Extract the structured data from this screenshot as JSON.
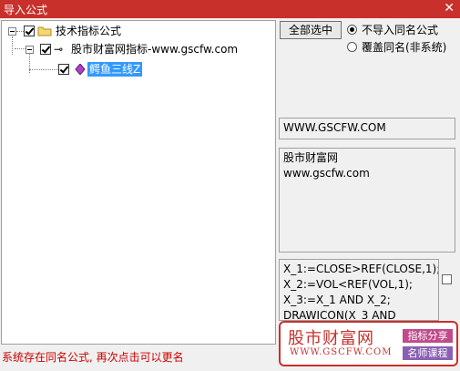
{
  "window": {
    "title": "导入公式",
    "close_glyph": "✕"
  },
  "tree": {
    "root_label": "技术指标公式",
    "child_label": "股市财富网指标-www.gscfw.com",
    "leaf_label": "鳄鱼三线Z"
  },
  "options": {
    "select_all_label": "全部选中",
    "radio_no_import": "不导入同名公式",
    "radio_overwrite": "覆盖同名(非系统)"
  },
  "info": {
    "website": "WWW.GSCFW.COM",
    "desc_line1": "股市财富网",
    "desc_line2": "www.gscfw.com",
    "code_lines": [
      "X_1:=CLOSE>REF(CLOSE,1);",
      "X_2:=VOL<REF(VOL,1);",
      "X_3:=X_1 AND X_2;",
      "DRAWICON(X_3 AND"
    ]
  },
  "status_text": "系统存在同名公式, 再次点击可以更名",
  "watermark": {
    "cn": "股市财富网",
    "en": "WWW.GSCFW.COM",
    "tag1": "指标分享",
    "tag2": "名师课程"
  },
  "colors": {
    "title_bar": "#c8302c",
    "selection": "#3399ff",
    "status": "#cc0000"
  }
}
